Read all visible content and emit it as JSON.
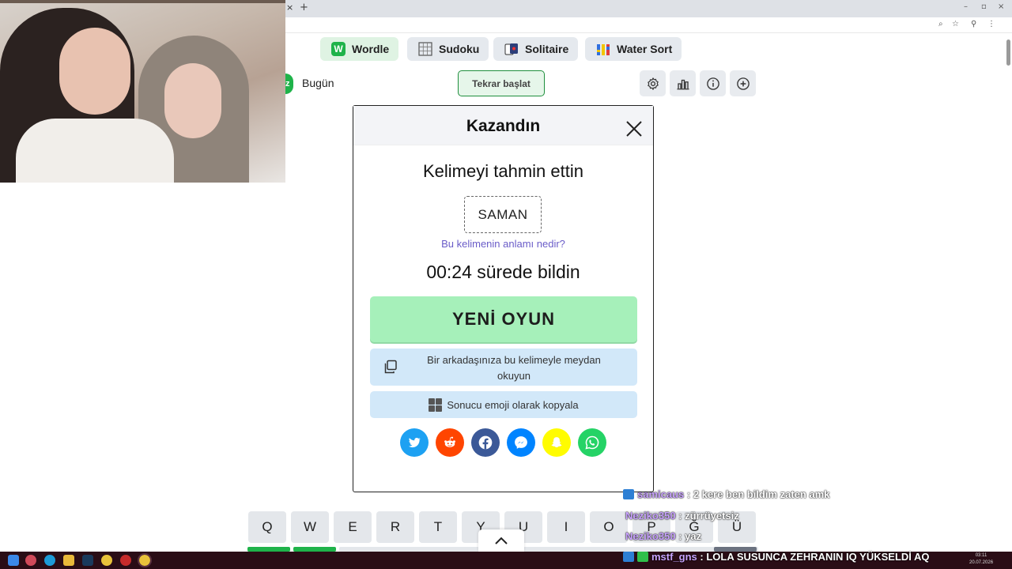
{
  "browser": {
    "tab_close": "×",
    "new_tab": "+",
    "window_controls": [
      "–",
      "▫",
      "×"
    ]
  },
  "game_tabs": [
    {
      "label": "Wordle",
      "icon": "wordle-icon",
      "color": "#1fb34a"
    },
    {
      "label": "Sudoku",
      "icon": "sudoku-grid-icon"
    },
    {
      "label": "Solitaire",
      "icon": "cards-icon"
    },
    {
      "label": "Water Sort",
      "icon": "water-sort-icon"
    }
  ],
  "toolbar": {
    "logo_letter": "z",
    "today_label": "Bugün",
    "restart_label": "Tekrar başlat",
    "icons": [
      "settings-icon",
      "stats-icon",
      "info-icon",
      "add-icon"
    ]
  },
  "modal": {
    "title": "Kazandın",
    "close_icon": "close-icon",
    "guessed_text": "Kelimeyi tahmin ettin",
    "word": "SAMAN",
    "meaning_link": "Bu kelimenin anlamı nedir?",
    "time_text": "00:24 sürede bildin",
    "new_game_label": "YENİ OYUN",
    "challenge_label": "Bir arkadaşınıza bu kelimeyle meydan okuyun",
    "copy_emoji_label": "Sonucu emoji olarak kopyala",
    "share": [
      {
        "name": "twitter",
        "color": "#1da1f2"
      },
      {
        "name": "reddit",
        "color": "#ff4500"
      },
      {
        "name": "facebook",
        "color": "#3b5998"
      },
      {
        "name": "messenger",
        "color": "#0084ff"
      },
      {
        "name": "snapchat",
        "color": "#fffc00"
      },
      {
        "name": "whatsapp",
        "color": "#25d366"
      }
    ]
  },
  "keyboard": {
    "row1": [
      "Q",
      "W",
      "E",
      "R",
      "T",
      "Y",
      "U",
      "I",
      "O",
      "P",
      "Ğ",
      "Ü"
    ]
  },
  "chat": [
    {
      "user": "samicaus",
      "sep": " : ",
      "message": "2 kere ben bildim zaten amk"
    },
    {
      "user": "Neziko350",
      "sep": " : ",
      "message": "zürrüyetsiz"
    },
    {
      "user": "Neziko350",
      "sep": " : ",
      "message": "yaz"
    },
    {
      "user": "mstf_gns",
      "sep": " : ",
      "message": "LOLA SUSUNCA ZEHRANIN IQ YÜKSELDİ AQ"
    }
  ],
  "taskbar": {
    "time": "03:11",
    "date": "20.07.2026"
  },
  "colors": {
    "accent_green": "#1fb34a",
    "new_game_bg": "#a6f0ba",
    "secondary_btn_bg": "#d2e8f9",
    "link_purple": "#6a5cc8"
  }
}
